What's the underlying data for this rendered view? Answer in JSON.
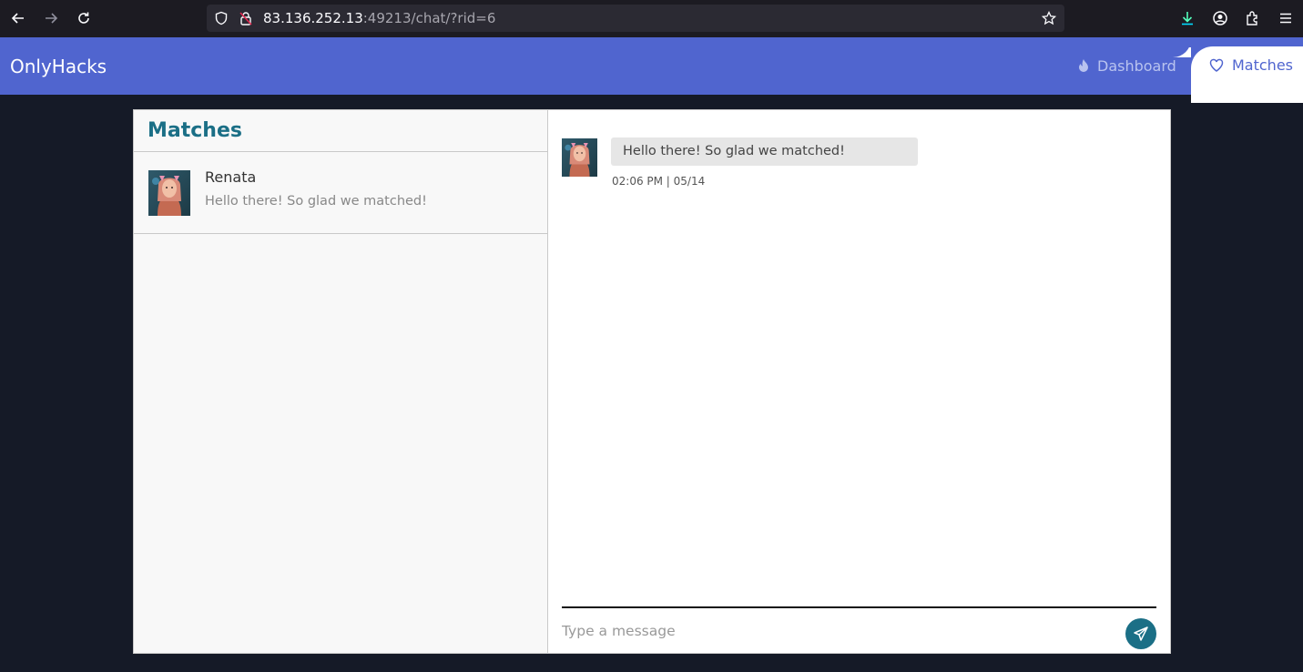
{
  "browser": {
    "url_host": "83.136.252.13",
    "url_rest": ":49213/chat/?rid=6",
    "icons": [
      "back-arrow-icon",
      "forward-arrow-icon",
      "reload-icon",
      "shield-icon",
      "insecure-lock-icon",
      "bookmark-star-icon",
      "download-icon",
      "account-icon",
      "extensions-icon",
      "menu-icon"
    ]
  },
  "header": {
    "brand": "OnlyHacks",
    "nav": {
      "dashboard_label": "Dashboard",
      "matches_label": "Matches"
    },
    "colors": {
      "bar": "#5065cf",
      "accent": "#1b6f86"
    }
  },
  "sidebar": {
    "title": "Matches",
    "items": [
      {
        "name": "Renata",
        "preview": "Hello there! So glad we matched!"
      }
    ]
  },
  "conversation": {
    "messages": [
      {
        "text": "Hello there! So glad we matched!",
        "time": "02:06 PM | 05/14"
      }
    ],
    "composer": {
      "placeholder": "Type a message"
    }
  }
}
